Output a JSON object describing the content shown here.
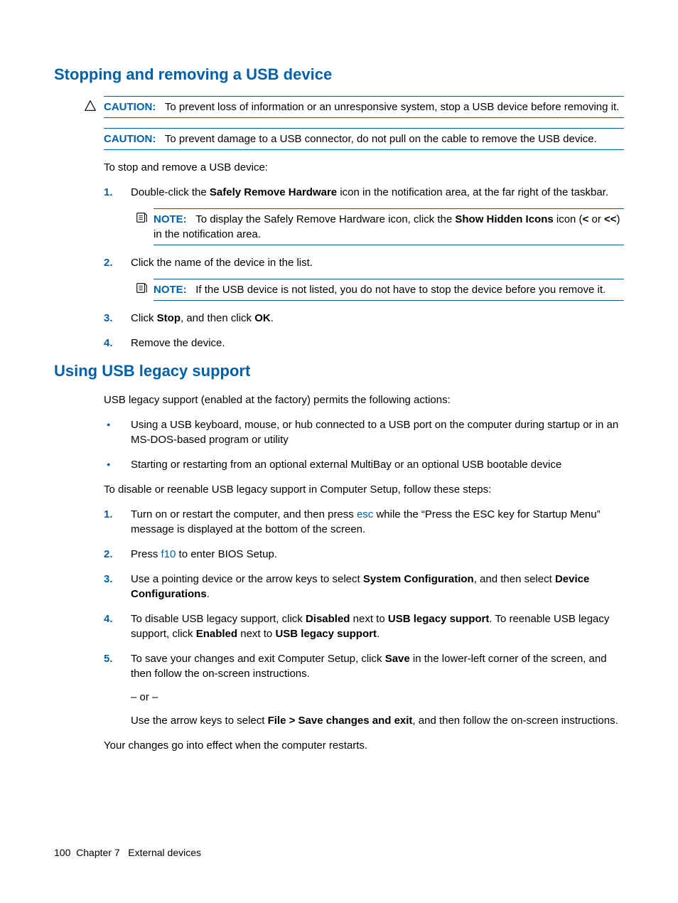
{
  "section1": {
    "heading": "Stopping and removing a USB device",
    "caution1": {
      "label": "CAUTION:",
      "text": "To prevent loss of information or an unresponsive system, stop a USB device before removing it."
    },
    "caution2": {
      "label": "CAUTION:",
      "text": "To prevent damage to a USB connector, do not pull on the cable to remove the USB device."
    },
    "intro": "To stop and remove a USB device:",
    "step1": {
      "pre": "Double-click the ",
      "b1": "Safely Remove Hardware",
      "post": " icon in the notification area, at the far right of the taskbar."
    },
    "note1": {
      "label": "NOTE:",
      "pre": "To display the Safely Remove Hardware icon, click the ",
      "b1": "Show Hidden Icons",
      "mid": " icon (",
      "b2": "<",
      "mid2": " or ",
      "b3": "<<",
      "post": ") in the notification area."
    },
    "step2": "Click the name of the device in the list.",
    "note2": {
      "label": "NOTE:",
      "text": "If the USB device is not listed, you do not have to stop the device before you remove it."
    },
    "step3": {
      "pre": "Click ",
      "b1": "Stop",
      "mid": ", and then click ",
      "b2": "OK",
      "post": "."
    },
    "step4": "Remove the device."
  },
  "section2": {
    "heading": "Using USB legacy support",
    "intro": "USB legacy support (enabled at the factory) permits the following actions:",
    "bullet1": "Using a USB keyboard, mouse, or hub connected to a USB port on the computer during startup or in an MS-DOS-based program or utility",
    "bullet2": "Starting or restarting from an optional external MultiBay or an optional USB bootable device",
    "intro2": "To disable or reenable USB legacy support in Computer Setup, follow these steps:",
    "step1": {
      "pre": "Turn on or restart the computer, and then press ",
      "key": "esc",
      "post": " while the “Press the ESC key for Startup Menu” message is displayed at the bottom of the screen."
    },
    "step2": {
      "pre": "Press ",
      "key": "f10",
      "post": " to enter BIOS Setup."
    },
    "step3": {
      "pre": "Use a pointing device or the arrow keys to select ",
      "b1": "System Configuration",
      "mid": ", and then select ",
      "b2": "Device Configurations",
      "post": "."
    },
    "step4": {
      "pre": "To disable USB legacy support, click ",
      "b1": "Disabled",
      "mid": " next to ",
      "b2": "USB legacy support",
      "mid2": ". To reenable USB legacy support, click ",
      "b3": "Enabled",
      "mid3": " next to ",
      "b4": "USB legacy support",
      "post": "."
    },
    "step5": {
      "pre": "To save your changes and exit Computer Setup, click ",
      "b1": "Save",
      "post": " in the lower-left corner of the screen, and then follow the on-screen instructions.",
      "or": "– or –",
      "alt_pre": "Use the arrow keys to select ",
      "alt_b": "File > Save changes and exit",
      "alt_post": ", and then follow the on-screen instructions."
    },
    "outro": "Your changes go into effect when the computer restarts."
  },
  "footer": {
    "page": "100",
    "chapter": "Chapter 7   External devices"
  }
}
